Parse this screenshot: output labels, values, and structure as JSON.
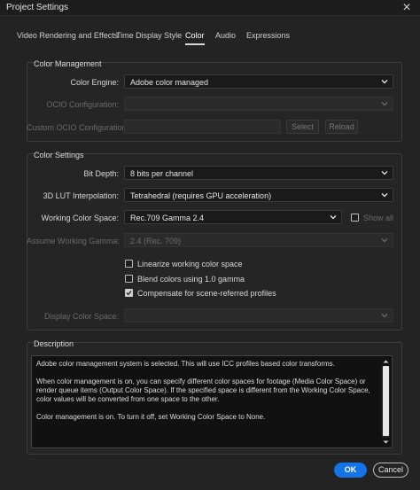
{
  "window": {
    "title": "Project Settings"
  },
  "tabs": [
    "Video Rendering and Effects",
    "Time Display Style",
    "Color",
    "Audio",
    "Expressions"
  ],
  "active_tab": "Color",
  "color_management": {
    "group_title": "Color Management",
    "color_engine_label": "Color Engine:",
    "color_engine_value": "Adobe color managed",
    "ocio_config_label": "OCIO Configuration:",
    "ocio_config_value": "",
    "custom_ocio_label": "Custom OCIO Configuration:",
    "custom_ocio_value": "",
    "select_button": "Select",
    "reload_button": "Reload"
  },
  "color_settings": {
    "group_title": "Color Settings",
    "bit_depth_label": "Bit Depth:",
    "bit_depth_value": "8 bits per channel",
    "lut_label": "3D LUT Interpolation:",
    "lut_value": "Tetrahedral (requires GPU acceleration)",
    "working_space_label": "Working Color Space:",
    "working_space_value": "Rec.709 Gamma 2.4",
    "show_all_label": "Show all",
    "show_all_checked": false,
    "assume_gamma_label": "Assume Working Gamma:",
    "assume_gamma_value": "2.4 (Rec. 709)",
    "linearize_label": "Linearize working color space",
    "linearize_checked": false,
    "blend_label": "Blend colors using 1.0 gamma",
    "blend_checked": false,
    "compensate_label": "Compensate for scene-referred profiles",
    "compensate_checked": true,
    "display_space_label": "Display Color Space:",
    "display_space_value": ""
  },
  "description": {
    "group_title": "Description",
    "paragraphs": [
      "Adobe color management system is selected. This will use ICC profiles based color transforms.",
      "When color management is on, you can specify different color spaces for footage (Media Color Space) or render queue items (Output Color Space). If the specified space is different from the Working Color Space, color values will be converted from one space to the other.",
      "Color management is on. To turn it off, set Working Color Space to None."
    ]
  },
  "buttons": {
    "ok": "OK",
    "cancel": "Cancel"
  },
  "colors": {
    "accent": "#1473e6",
    "background": "#232323",
    "panel_border": "#3d3d3d"
  }
}
